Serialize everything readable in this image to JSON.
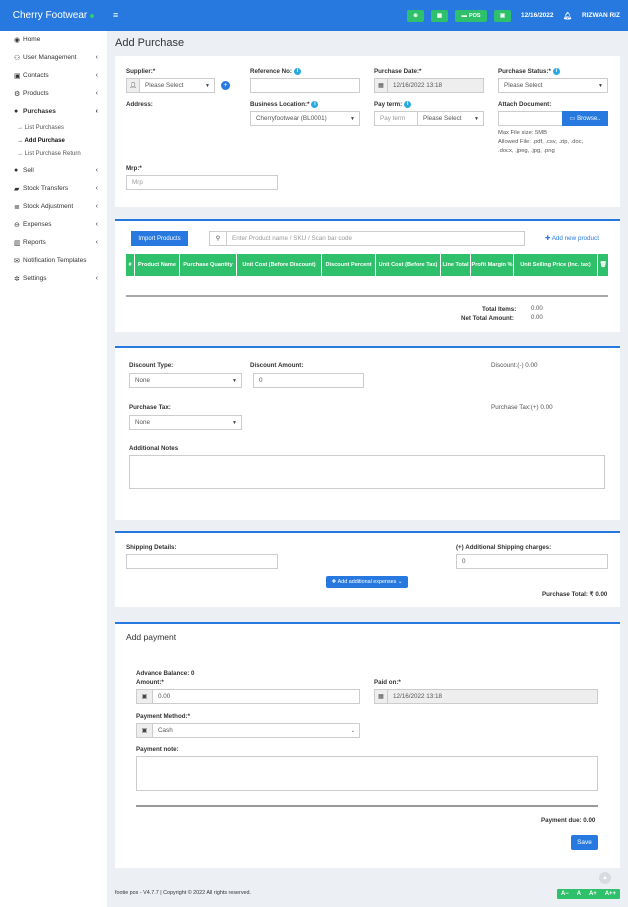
{
  "brand": {
    "name": "Cherry Footwear"
  },
  "topbar": {
    "pos_label": "POS",
    "date": "12/16/2022",
    "user": "RIZWAN RIZ"
  },
  "sidebar": {
    "items": [
      {
        "label": "Home"
      },
      {
        "label": "User Management"
      },
      {
        "label": "Contacts"
      },
      {
        "label": "Products"
      },
      {
        "label": "Purchases"
      },
      {
        "label": "Sell"
      },
      {
        "label": "Stock Transfers"
      },
      {
        "label": "Stock Adjustment"
      },
      {
        "label": "Expenses"
      },
      {
        "label": "Reports"
      },
      {
        "label": "Notification Templates"
      },
      {
        "label": "Settings"
      }
    ],
    "sub": [
      {
        "label": "→ List Purchases"
      },
      {
        "label": "→ Add Purchase"
      },
      {
        "label": "→ List Purchase Return"
      }
    ]
  },
  "page": {
    "title": "Add Purchase"
  },
  "form": {
    "supplier_label": "Supplier:*",
    "supplier_value": "Please Select",
    "reference_label": "Reference No:",
    "purchase_date_label": "Purchase Date:*",
    "purchase_date_value": "12/16/2022 13:18",
    "purchase_status_label": "Purchase Status:*",
    "purchase_status_value": "Please Select",
    "address_label": "Address:",
    "business_location_label": "Business Location:*",
    "business_location_value": "Cherryfootwear (BL0001)",
    "pay_term_label": "Pay term:",
    "pay_term_placeholder": "Pay term",
    "pay_term_select": "Please Select",
    "attach_label": "Attach Document:",
    "browse_label": "Browse..",
    "file_help": [
      "Max File size: 5MB",
      "Allowed File: .pdf, .csv, .zip, .doc,",
      ".docx, .jpeg, .jpg, .png"
    ],
    "mrp_label": "Mrp:*",
    "mrp_placeholder": "Mrp"
  },
  "products": {
    "import_label": "Import Products",
    "search_placeholder": "Enter Product name / SKU / Scan bar code",
    "add_new_label": "Add new product",
    "columns": [
      "#",
      "Product Name",
      "Purchase Quantity",
      "Unit Cost (Before Discount)",
      "Discount Percent",
      "Unit Cost (Before Tax)",
      "Line Total",
      "Profit Margin %",
      "Unit Selling Price (Inc. tax)"
    ],
    "total_items_label": "Total Items:",
    "total_items_value": "0.00",
    "net_total_label": "Net Total Amount:",
    "net_total_value": "0.00"
  },
  "discount": {
    "type_label": "Discount Type:",
    "type_value": "None",
    "amount_label": "Discount Amount:",
    "amount_value": "0",
    "discount_summary": "Discount:(-) 0.00",
    "tax_label": "Purchase Tax:",
    "tax_value": "None",
    "tax_summary": "Purchase Tax:(+) 0.00",
    "notes_label": "Additional Notes"
  },
  "shipping": {
    "details_label": "Shipping Details:",
    "charges_label": "(+) Additional Shipping charges:",
    "charges_value": "0",
    "add_expenses_label": "Add additional expenses",
    "purchase_total": "Purchase Total: ₹ 0.00"
  },
  "payment": {
    "title": "Add payment",
    "advance_balance": "Advance Balance: 0",
    "amount_label": "Amount:*",
    "amount_value": "0.00",
    "paid_on_label": "Paid on:*",
    "paid_on_value": "12/16/2022 13:18",
    "method_label": "Payment Method:*",
    "method_value": "Cash",
    "note_label": "Payment note:",
    "due": "Payment due: 0.00",
    "save_label": "Save"
  },
  "footer": {
    "text": "footie pos - V4.7.7 | Copyright © 2022 All rights reserved.",
    "font_buttons": [
      "A−",
      "A",
      "A+",
      "A++"
    ]
  },
  "colors": {
    "primary": "#2779e0",
    "success": "#2ec06a",
    "info": "#29a9e0"
  }
}
